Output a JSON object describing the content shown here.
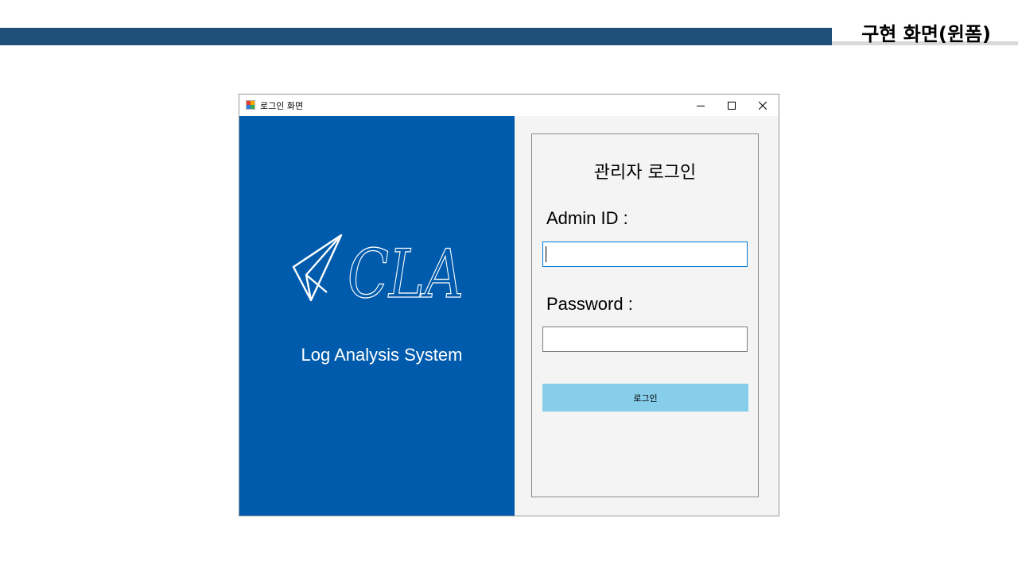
{
  "slide": {
    "title": "구현 화면(윈폼)"
  },
  "window": {
    "title": "로그인 화면",
    "icon": "winforms-app-icon",
    "controls": {
      "minimize_icon": "minimize-icon",
      "maximize_icon": "maximize-icon",
      "close_icon": "close-icon"
    }
  },
  "brand": {
    "logo_text": "CLA",
    "logo_icon": "paper-plane-icon",
    "tagline": "Log Analysis System"
  },
  "login": {
    "heading": "관리자 로그인",
    "id_label": "Admin ID :",
    "id_value": "",
    "password_label": "Password :",
    "password_value": "",
    "button_label": "로그인"
  },
  "colors": {
    "header_bar": "#1f4e79",
    "left_panel": "#005bac",
    "login_button": "#87ceeb",
    "focus_border": "#0078d7"
  }
}
